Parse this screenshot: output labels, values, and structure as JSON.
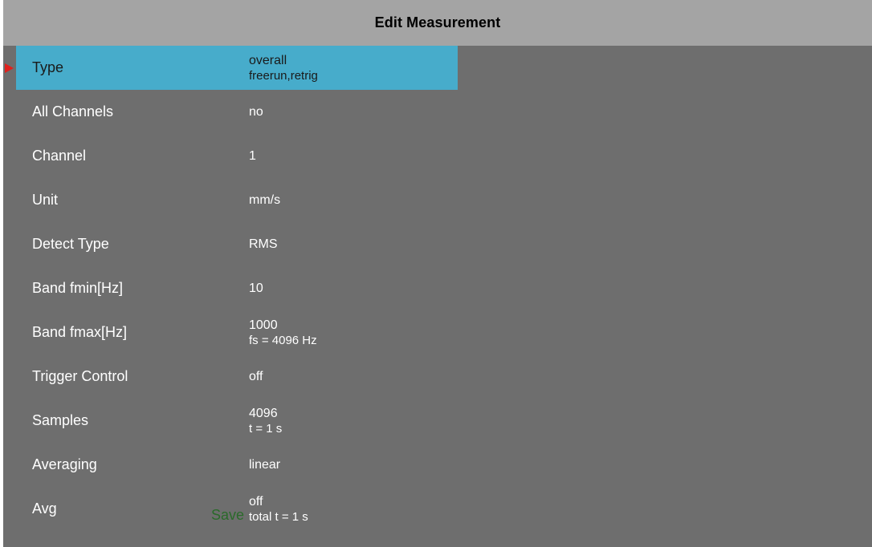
{
  "title": "Edit Measurement",
  "colors": {
    "panel_bg": "#6e6e6e",
    "titlebar_bg": "#a4a4a4",
    "selected_row_bg": "#47accb",
    "pointer": "#e0201c",
    "save_text": "#2a6a2a"
  },
  "pointer_icon": "red-triangle-pointer",
  "rows": [
    {
      "label": "Type",
      "value": "overall",
      "sub": "freerun,retrig",
      "selected": true
    },
    {
      "label": "All Channels",
      "value": "no",
      "sub": ""
    },
    {
      "label": "Channel",
      "value": "1",
      "sub": ""
    },
    {
      "label": "Unit",
      "value": "mm/s",
      "sub": ""
    },
    {
      "label": "Detect Type",
      "value": "RMS",
      "sub": ""
    },
    {
      "label": "Band fmin[Hz]",
      "value": "10",
      "sub": ""
    },
    {
      "label": "Band fmax[Hz]",
      "value": "1000",
      "sub": "fs = 4096 Hz"
    },
    {
      "label": "Trigger Control",
      "value": "off",
      "sub": ""
    },
    {
      "label": "Samples",
      "value": "4096",
      "sub": "t = 1 s"
    },
    {
      "label": "Averaging",
      "value": "linear",
      "sub": ""
    },
    {
      "label": "Avg",
      "value": "off",
      "sub": "total t = 1 s"
    }
  ],
  "save_label": "Save"
}
